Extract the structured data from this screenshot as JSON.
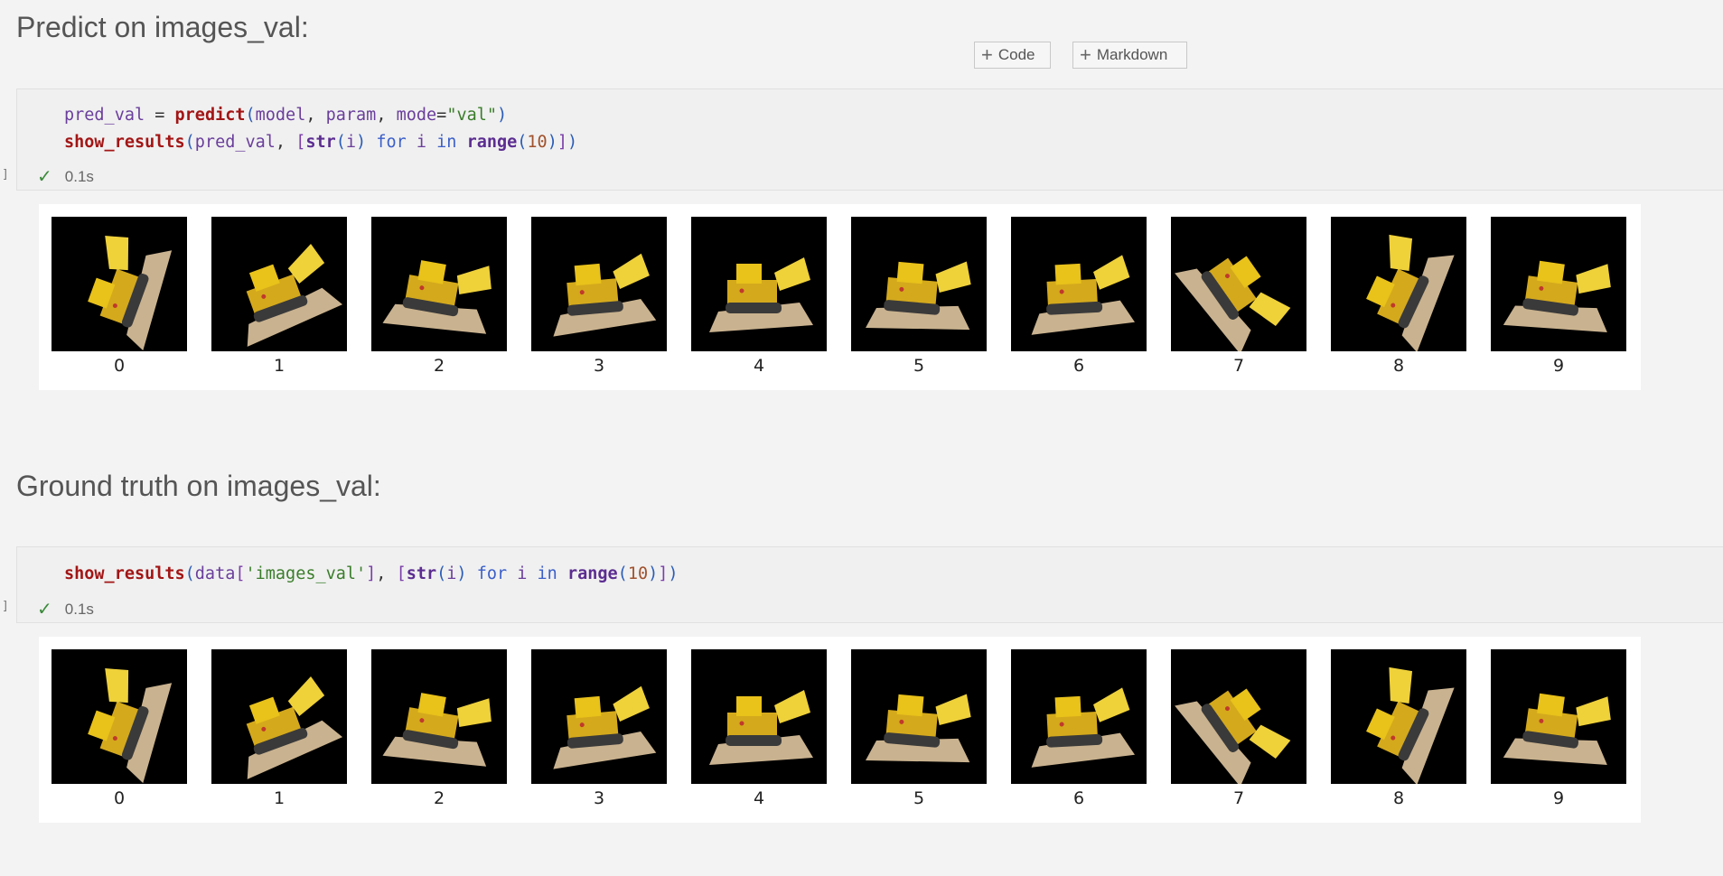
{
  "toolbar": {
    "code_label": "Code",
    "markdown_label": "Markdown",
    "plus_glyph": "+"
  },
  "cells": [
    {
      "heading": "Predict on images_val:",
      "gutter": "]",
      "status_time": "0.1s",
      "code_lines": [
        "pred_val = predict(model, param, mode=\"val\")",
        "show_results(pred_val, [str(i) for i in range(10)])"
      ],
      "image_labels": [
        "0",
        "1",
        "2",
        "3",
        "4",
        "5",
        "6",
        "7",
        "8",
        "9"
      ]
    },
    {
      "heading": "Ground truth on images_val:",
      "gutter": "]",
      "status_time": "0.1s",
      "code_lines": [
        "show_results(data['images_val'], [str(i) for i in range(10)])"
      ],
      "image_labels": [
        "0",
        "1",
        "2",
        "3",
        "4",
        "5",
        "6",
        "7",
        "8",
        "9"
      ]
    }
  ],
  "icons": {
    "status": "checkmark-icon",
    "thumbnail": "lego-bulldozer-render"
  },
  "colors": {
    "background": "#f3f3f3",
    "cell_background": "#f0f0f0",
    "success": "#3b8a3b",
    "thumbnail_bg": "#000000",
    "model_yellow": "#e9c21a"
  }
}
